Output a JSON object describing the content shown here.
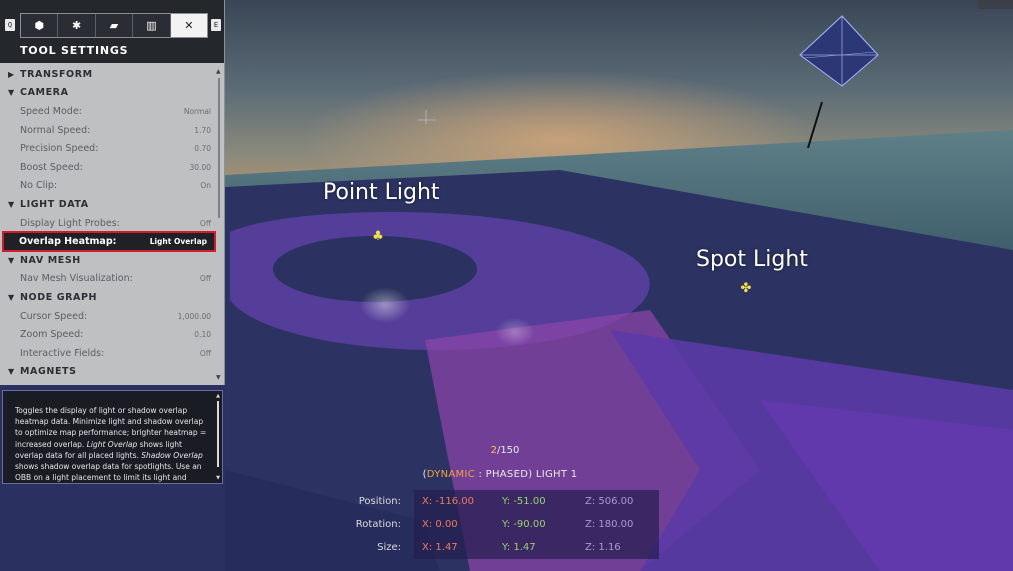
{
  "panel": {
    "key_left": "Q",
    "key_right": "E",
    "tabs": [
      {
        "icon": "cube-select-icon",
        "glyph": "⬢"
      },
      {
        "icon": "gear-icon",
        "glyph": "✱"
      },
      {
        "icon": "folder-icon",
        "glyph": "▰"
      },
      {
        "icon": "map-icon",
        "glyph": "▥"
      },
      {
        "icon": "tools-icon",
        "glyph": "✕"
      }
    ],
    "title": "TOOL SETTINGS",
    "sections": {
      "transform": {
        "label": "TRANSFORM",
        "expanded": false
      },
      "camera": {
        "label": "CAMERA",
        "rows": [
          {
            "label": "Speed Mode:",
            "value": "Normal"
          },
          {
            "label": "Normal Speed:",
            "value": "1.70"
          },
          {
            "label": "Precision Speed:",
            "value": "0.70"
          },
          {
            "label": "Boost Speed:",
            "value": "30.00"
          },
          {
            "label": "No Clip:",
            "value": "On"
          }
        ]
      },
      "light_data": {
        "label": "LIGHT DATA",
        "rows": [
          {
            "label": "Display Light Probes:",
            "value": "Off"
          },
          {
            "label": "Overlap Heatmap:",
            "value": "Light Overlap"
          }
        ]
      },
      "nav_mesh": {
        "label": "NAV MESH",
        "rows": [
          {
            "label": "Nav Mesh Visualization:",
            "value": "Off"
          }
        ]
      },
      "node_graph": {
        "label": "NODE GRAPH",
        "rows": [
          {
            "label": "Cursor Speed:",
            "value": "1,000.00"
          },
          {
            "label": "Zoom Speed:",
            "value": "0.10"
          },
          {
            "label": "Interactive Fields:",
            "value": "Off"
          }
        ]
      },
      "magnets": {
        "label": "MAGNETS"
      }
    }
  },
  "description": {
    "part1": "Toggles the display of light or shadow overlap heatmap data. Minimize light and shadow overlap to optimize map performance; brighter heatmap = increased overlap. ",
    "em1": "Light Overlap",
    "part2": " shows light overlap data for all placed lights. ",
    "em2": "Shadow Overlap",
    "part3": " shows shadow overlap data for spotlights.  Use an OBB on a light placement to limit its light and shadow overlap."
  },
  "scene": {
    "point_light_label": "Point Light",
    "spot_light_label": "Spot Light"
  },
  "hud": {
    "counter_current": "2",
    "counter_total": "/150",
    "name_open": "(",
    "name_dynamic": "DYNAMIC",
    "name_rest": " : PHASED) LIGHT 1",
    "position": {
      "label": "Position:",
      "x": "X: -116.00",
      "y": "Y: -51.00",
      "z": "Z: 506.00"
    },
    "rotation": {
      "label": "Rotation:",
      "x": "X: 0.00",
      "y": "Y: -90.00",
      "z": "Z: 180.00"
    },
    "size": {
      "label": "Size:",
      "x": "X: 1.47",
      "y": "Y: 1.47",
      "z": "Z: 1.16"
    }
  },
  "colors": {
    "highlight_outline": "#d01c2c",
    "dynamic_text": "#f0a43c",
    "x_axis": "#f07a5d",
    "y_axis": "#9ad26d",
    "z_axis": "#a99ad6"
  }
}
